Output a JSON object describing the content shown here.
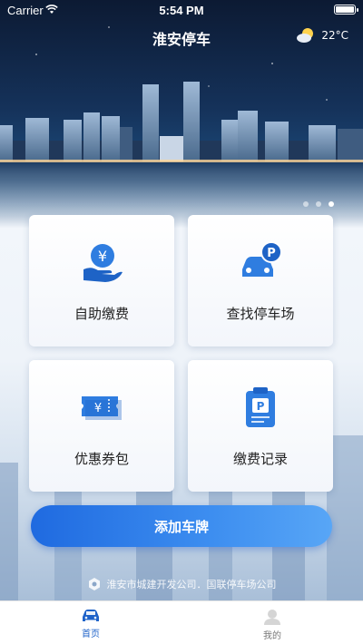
{
  "status_bar": {
    "carrier": "Carrier",
    "time": "5:54 PM"
  },
  "header": {
    "title": "淮安停车",
    "weather_temp": "22°C"
  },
  "carousel": {
    "page_count": 3,
    "active_index": 2
  },
  "menu": [
    {
      "label": "自助缴费",
      "icon": "yen-hand-icon"
    },
    {
      "label": "查找停车场",
      "icon": "car-parking-icon"
    },
    {
      "label": "优惠券包",
      "icon": "coupon-ticket-icon"
    },
    {
      "label": "缴费记录",
      "icon": "parking-clipboard-icon"
    }
  ],
  "add_plate_label": "添加车牌",
  "footer_note": "淮安市城建开发公司．国联停车场公司",
  "tabs": [
    {
      "label": "首页",
      "icon": "car-icon",
      "active": true
    },
    {
      "label": "我的",
      "icon": "user-icon",
      "active": false
    }
  ],
  "colors": {
    "accent": "#1f63c9",
    "button_start": "#1f6ae0",
    "button_end": "#58a6f6"
  }
}
